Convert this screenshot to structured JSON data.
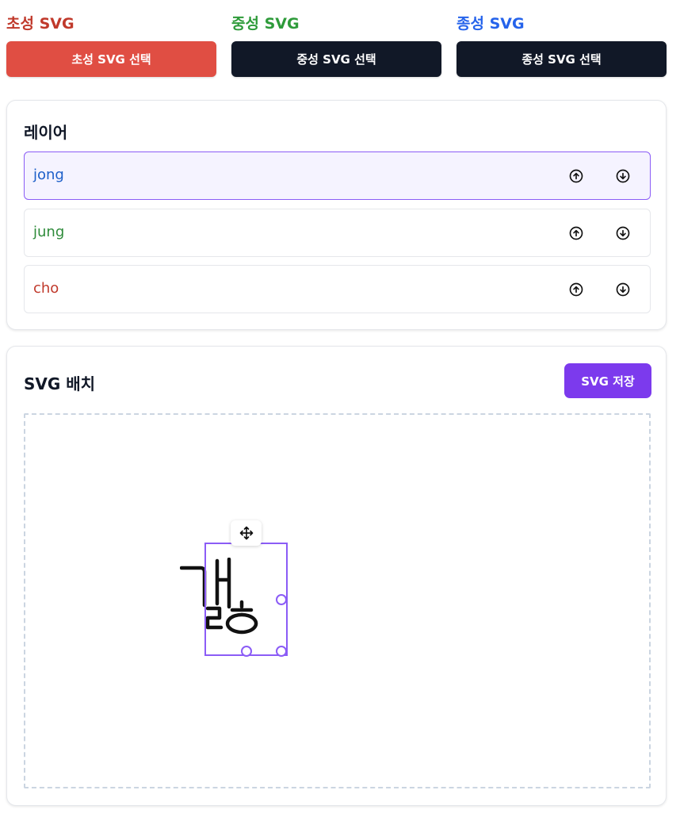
{
  "pickers": [
    {
      "title": "초성 SVG",
      "title_color": "#c0392b",
      "button_label": "초성 SVG 선택",
      "button_color": "#e04e43"
    },
    {
      "title": "중성 SVG",
      "title_color": "#2e9b3a",
      "button_label": "중성 SVG 선택",
      "button_color": "#111827"
    },
    {
      "title": "종성 SVG",
      "title_color": "#2563eb",
      "button_label": "종성 SVG 선택",
      "button_color": "#111827"
    }
  ],
  "layers": {
    "heading": "레이어",
    "items": [
      {
        "name": "jong",
        "color": "#1d5fc9",
        "selected": true
      },
      {
        "name": "jung",
        "color": "#2e8b3a",
        "selected": false
      },
      {
        "name": "cho",
        "color": "#c0392b",
        "selected": false
      }
    ]
  },
  "canvas": {
    "heading": "SVG 배치",
    "save_label": "SVG 저장",
    "accent_color": "#7c3aed"
  },
  "icons": {
    "move": "move-arrows-icon",
    "layer_up": "arrow-up-circle-icon",
    "layer_down": "arrow-down-circle-icon"
  }
}
